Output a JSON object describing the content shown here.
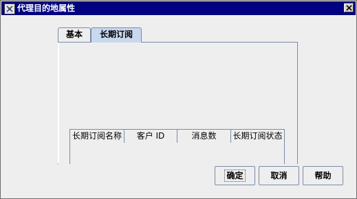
{
  "window": {
    "title": "代理目的地属性",
    "close_glyph": "✕"
  },
  "tabs": [
    {
      "label": "基本",
      "selected": false
    },
    {
      "label": "长期订阅",
      "selected": true
    }
  ],
  "table": {
    "columns": [
      "长期订阅名称",
      "客户 ID",
      "消息数",
      "长期订阅状态"
    ],
    "rows": []
  },
  "buttons": {
    "ok": "确定",
    "cancel": "取消",
    "help": "帮助"
  },
  "colors": {
    "titlebar": "#000080",
    "active_tab": "#c8d8ee",
    "border": "#7a8aa8"
  }
}
